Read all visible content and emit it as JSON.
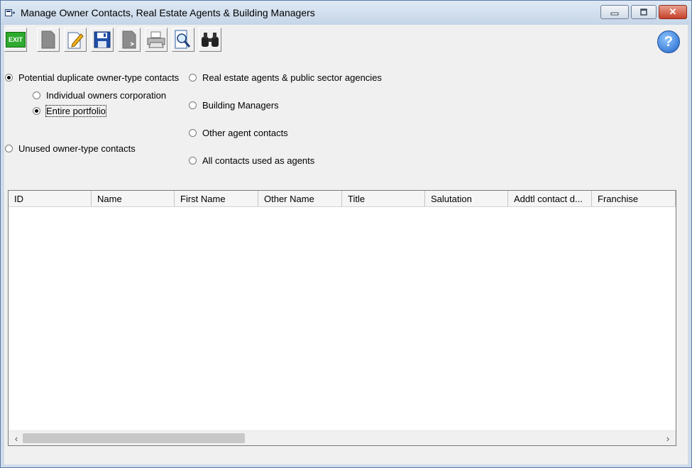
{
  "window": {
    "title": "Manage Owner Contacts, Real Estate Agents & Building Managers",
    "controls": {
      "minimize": "–",
      "maximize": "☐",
      "close": "✕"
    }
  },
  "toolbar": {
    "exit_label": "EXIT",
    "help_label": "?",
    "buttons": [
      {
        "name": "new-document-icon"
      },
      {
        "name": "edit-icon"
      },
      {
        "name": "save-icon"
      },
      {
        "name": "export-icon"
      },
      {
        "name": "print-icon"
      },
      {
        "name": "print-preview-icon"
      },
      {
        "name": "binoculars-icon"
      }
    ]
  },
  "filters": {
    "potential_duplicate": {
      "label": "Potential duplicate owner-type contacts",
      "checked": true
    },
    "individual_owners": {
      "label": "Individual owners corporation",
      "checked": false
    },
    "entire_portfolio": {
      "label": "Entire portfolio",
      "checked": true
    },
    "unused_owner": {
      "label": "Unused owner-type contacts",
      "checked": false
    },
    "real_estate_agents": {
      "label": "Real estate agents & public sector agencies",
      "checked": false
    },
    "building_managers": {
      "label": "Building Managers",
      "checked": false
    },
    "other_agent": {
      "label": "Other agent contacts",
      "checked": false
    },
    "all_contacts_agents": {
      "label": "All contacts used as agents",
      "checked": false
    }
  },
  "grid": {
    "columns": [
      "ID",
      "Name",
      "First Name",
      "Other Name",
      "Title",
      "Salutation",
      "Addtl contact d...",
      "Franchise"
    ],
    "rows": [],
    "scroll_left": "‹",
    "scroll_right": "›"
  },
  "colors": {
    "exit_green": "#2eaa2e",
    "close_red": "#c6402a",
    "help_blue": "#1d63c8"
  }
}
